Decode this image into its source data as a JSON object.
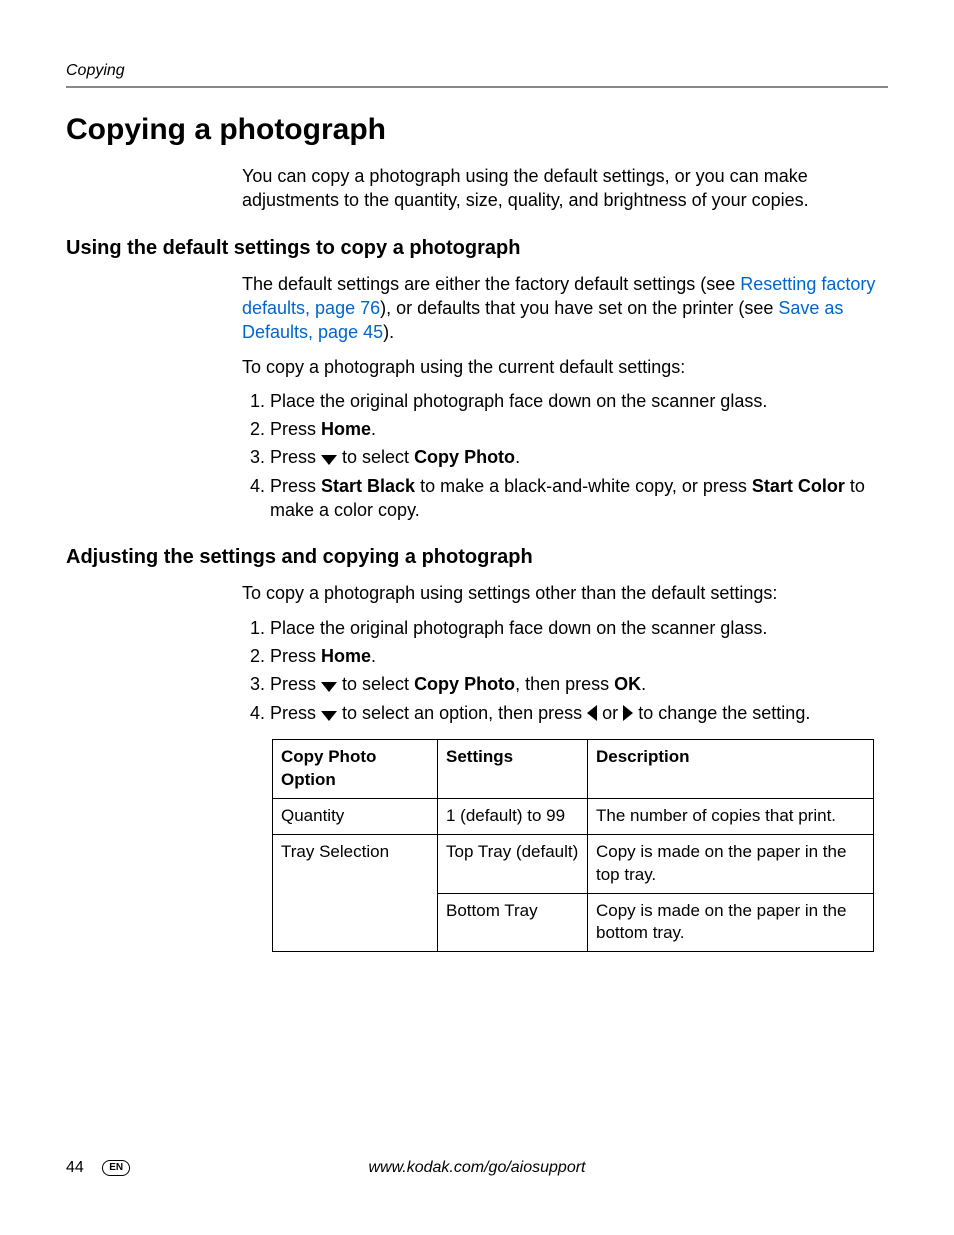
{
  "running_head": "Copying",
  "title": "Copying a photograph",
  "intro": "You can copy a photograph using the default settings, or you can make adjustments to the quantity, size, quality, and brightness of your copies.",
  "section1": {
    "heading": "Using the default settings to copy a photograph",
    "para1_pre": "The default settings are either the factory default settings (see ",
    "link1": "Resetting factory defaults, page 76",
    "para1_mid": "), or defaults that you have set on the printer (see ",
    "link2": "Save as Defaults, page 45",
    "para1_post": ").",
    "lead": "To copy a photograph using the current default settings:",
    "step1": "Place the original photograph face down on the scanner glass.",
    "step2_pre": "Press ",
    "step2_bold": "Home",
    "step2_post": ".",
    "step3_pre": "Press ",
    "step3_mid": " to select ",
    "step3_bold": "Copy Photo",
    "step3_post": ".",
    "step4_pre": "Press ",
    "step4_b1": "Start Black",
    "step4_mid": " to make a black-and-white copy, or press ",
    "step4_b2": "Start Color",
    "step4_post": " to make a color copy."
  },
  "section2": {
    "heading": "Adjusting the settings and copying a photograph",
    "lead": "To copy a photograph using settings other than the default settings:",
    "step1": "Place the original photograph face down on the scanner glass.",
    "step2_pre": "Press ",
    "step2_bold": "Home",
    "step2_post": ".",
    "step3_pre": "Press ",
    "step3_mid": " to select ",
    "step3_b1": "Copy Photo",
    "step3_mid2": ", then press ",
    "step3_b2": "OK",
    "step3_post": ".",
    "step4_pre": "Press ",
    "step4_mid1": " to select an option, then press ",
    "step4_mid2": " or ",
    "step4_post": " to change the setting."
  },
  "table": {
    "h1": "Copy Photo Option",
    "h2": "Settings",
    "h3": "Description",
    "r1c1": "Quantity",
    "r1c2": "1 (default) to 99",
    "r1c3": "The number of copies that print.",
    "r2c1": "Tray Selection",
    "r2c2": "Top Tray (default)",
    "r2c3": "Copy is made on the paper in the top tray.",
    "r3c2": "Bottom Tray",
    "r3c3": "Copy is made on the paper in the bottom tray."
  },
  "footer": {
    "page": "44",
    "lang": "EN",
    "url": "www.kodak.com/go/aiosupport"
  }
}
